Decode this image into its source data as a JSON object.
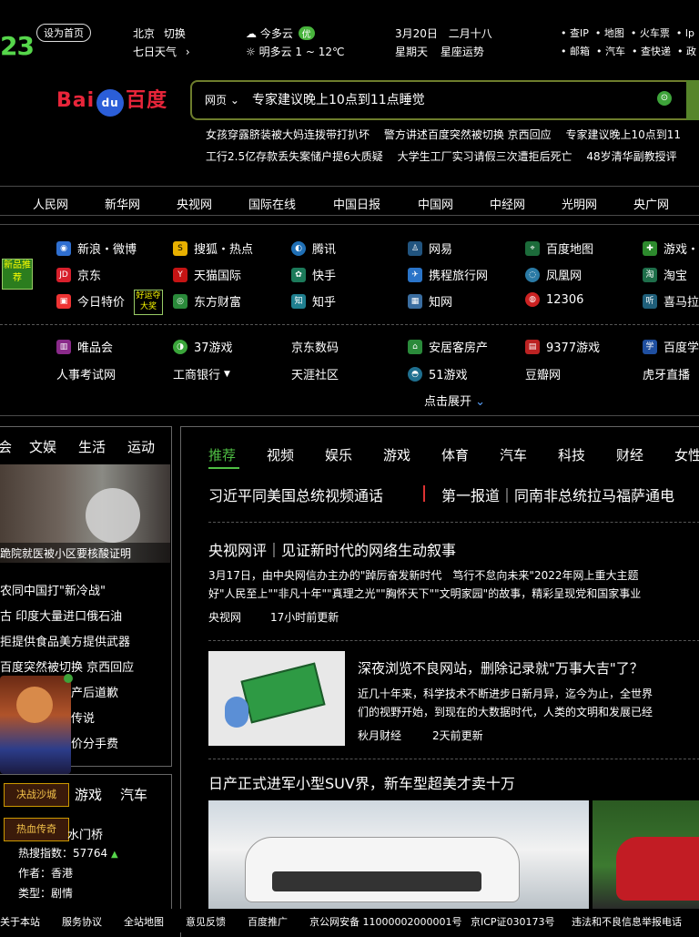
{
  "topbar": {
    "logo": "23",
    "set_home": "设为首页",
    "city": "北京",
    "switch": "切换",
    "week_weather": "七日天气",
    "today_label": "今多云",
    "aqi": "优",
    "tomorrow": "明多云 1 ~ 12℃",
    "date": "3月20日",
    "lunar": "二月十八",
    "weekday": "星期天",
    "constellation": "星座运势",
    "links_row1": [
      "查IP",
      "地图",
      "火车票",
      "lp"
    ],
    "links_row2": [
      "邮箱",
      "汽车",
      "查快递",
      "政"
    ]
  },
  "search": {
    "logo_text_left": "Bai",
    "logo_paw": "du",
    "logo_text_right": "百度",
    "category": "网页",
    "query": "专家建议晚上10点到11点睡觉"
  },
  "hot_searches": {
    "row1": [
      "女孩穿露脐装被大妈连拨带打扒坏",
      "警方讲述百度突然被切换 京西回应",
      "专家建议晚上10点到11"
    ],
    "row2": [
      "工行2.5亿存款丢失案储户提6大质疑",
      "大学生工厂实习请假三次遭拒后死亡",
      "48岁清华副教授评"
    ]
  },
  "media_links": [
    "人民网",
    "新华网",
    "央视网",
    "国际在线",
    "中国日报",
    "中国网",
    "中经网",
    "光明网",
    "央广网"
  ],
  "sites": {
    "promo1": "新品推荐",
    "promo2": "好运夺大奖",
    "col1": [
      "新浪・微博",
      "京东",
      "今日特价"
    ],
    "col2": [
      "搜狐・热点",
      "天猫国际",
      "东方财富"
    ],
    "col3": [
      "腾讯",
      "快手",
      "知乎"
    ],
    "col4": [
      "网易",
      "携程旅行网",
      "知网"
    ],
    "col5": [
      "百度地图",
      "凤凰网",
      "12306"
    ],
    "col6": [
      "游戏・",
      "淘宝",
      "喜马拉"
    ],
    "row4": [
      "唯品会",
      "37游戏",
      "京东数码",
      "安居客房产",
      "9377游戏",
      "百度学"
    ],
    "row5": [
      "人事考试网",
      "工商银行",
      "天涯社区",
      "51游戏",
      "豆瓣网",
      "虎牙直播"
    ],
    "expand": "点击展开"
  },
  "left": {
    "tabs": [
      "会",
      "文娱",
      "生活",
      "运动"
    ],
    "photo_caption": "跪院就医被小区要核酸证明",
    "news": [
      "农同中国打\"新冷战\"",
      "古 印度大量进口俄石油",
      "拒提供食品美方提供武器",
      "百度突然被切换 京西回应",
      "产后道歉",
      "传说",
      "价分手费"
    ],
    "tabs2": [
      "游戏",
      "汽车"
    ],
    "game1": "决战沙城",
    "game2": "热血传奇",
    "drama_title": "水门桥",
    "hot_index_label": "热搜指数：",
    "hot_index": "57764",
    "author": "作者：香港",
    "type": "类型：剧情"
  },
  "feed": {
    "tabs": [
      "推荐",
      "视频",
      "娱乐",
      "游戏",
      "体育",
      "汽车",
      "科技",
      "财经",
      "女性"
    ],
    "headline_left": "习近平同美国总统视频通话",
    "headline_right": "第一报道｜同南非总统拉马福萨通电",
    "article1": {
      "title": "央视网评｜见证新时代的网络生动叙事",
      "line1": "3月17日，由中央网信办主办的\"踔厉奋发新时代　笃行不怠向未来\"2022年网上重大主题",
      "line2": "好\"人民至上\"\"非凡十年\"\"真理之光\"\"胸怀天下\"\"文明家园\"的故事，精彩呈现党和国家事业",
      "source": "央视网",
      "time": "17小时前更新"
    },
    "article2": {
      "title": "深夜浏览不良网站，删除记录就\"万事大吉\"了？",
      "line1": "近几十年来，科学技术不断进步日新月异，迄今为止，全世界",
      "line2": "们的视野开始，到现在的大数据时代，人类的文明和发展已经",
      "source": "秋月财经",
      "time": "2天前更新"
    },
    "article3": {
      "title": "日产正式进军小型SUV界，新车型超美才卖十万"
    }
  },
  "footer": [
    "关于本站",
    "服务协议",
    "全站地图",
    "意见反馈",
    "百度推广",
    "京公网安备 11000002000001号",
    "京ICP证030173号",
    "违法和不良信息举报电话"
  ]
}
